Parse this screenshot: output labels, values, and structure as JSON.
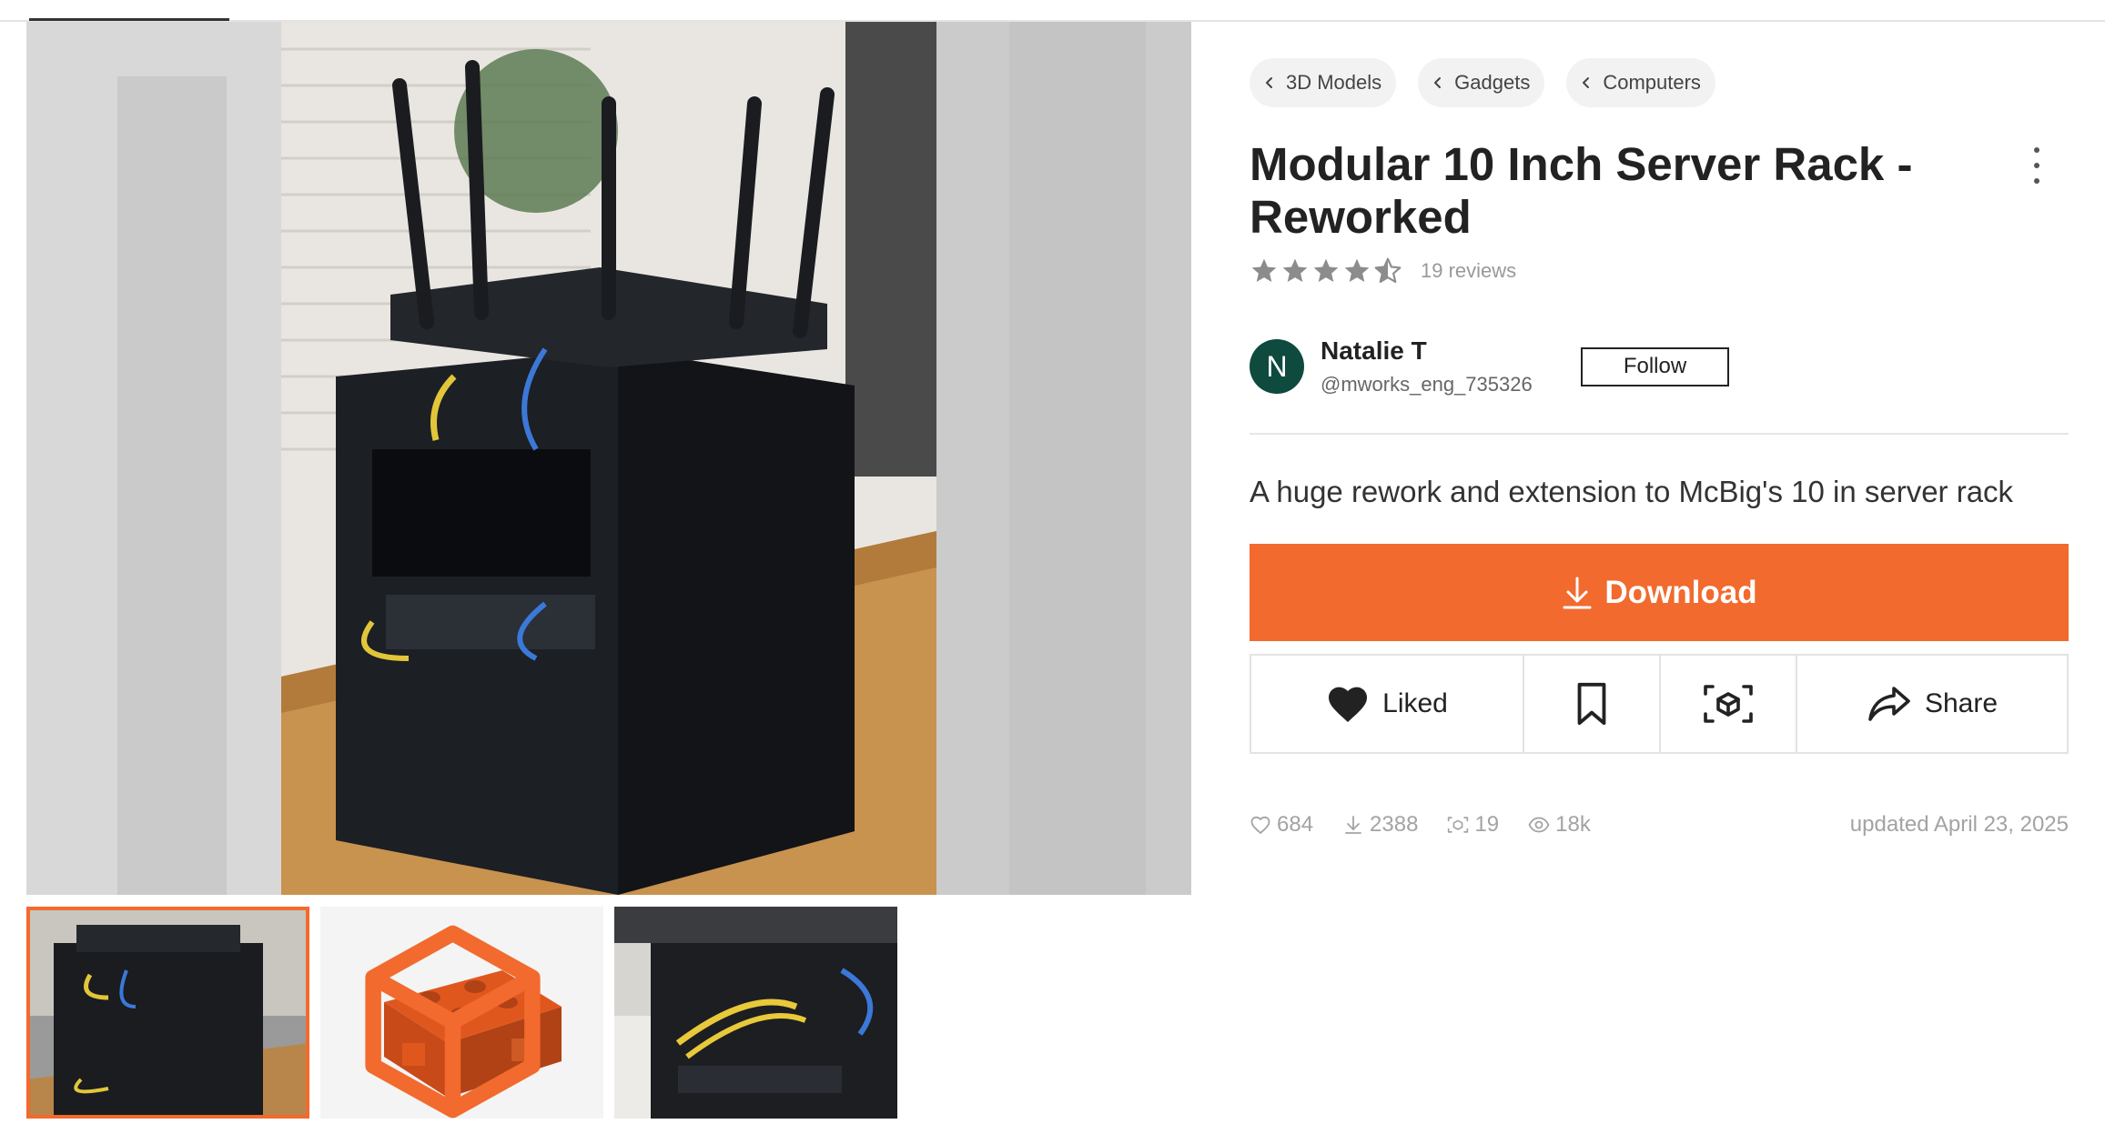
{
  "gallery": {
    "main_image_alt": "",
    "thumbnails": [
      "",
      "",
      ""
    ],
    "selected_index": 0
  },
  "breadcrumbs": [
    {
      "label": "3D Models"
    },
    {
      "label": "Gadgets"
    },
    {
      "label": "Computers"
    }
  ],
  "title": "Modular 10 Inch Server Rack - Reworked",
  "rating": {
    "stars": 4.5,
    "max": 5,
    "reviews": "19 reviews"
  },
  "author": {
    "initial": "N",
    "name": "Natalie T",
    "handle": "@mworks_eng_735326",
    "follow_label": "Follow"
  },
  "summary": "A huge rework and extension to McBig's 10 in server rack",
  "download_label": "Download",
  "actions": {
    "like_label": "Liked",
    "share_label": "Share"
  },
  "stats": {
    "likes": "684",
    "downloads": "2388",
    "makes": "19",
    "views": "18k",
    "updated": "updated April 23, 2025"
  },
  "icons": [
    "chevron-left-icon",
    "star-icon",
    "more-vertical-icon",
    "download-icon",
    "heart-icon",
    "bookmark-icon",
    "ar-view-icon",
    "share-icon",
    "eye-icon",
    "cube-icon"
  ],
  "colors": {
    "accent": "#f26a2e",
    "avatar": "#0e4a3e",
    "muted": "#a3a3a3",
    "star": "#8c8c8c"
  }
}
